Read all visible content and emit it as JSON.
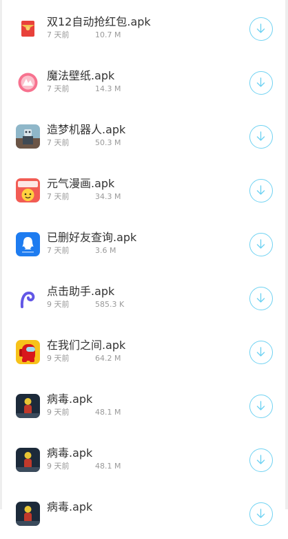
{
  "files": [
    {
      "name": "双12自动抢红包.apk",
      "age": "7 天前",
      "size": "10.7 M",
      "icon": "red-envelope-app-icon"
    },
    {
      "name": "魔法壁纸.apk",
      "age": "7 天前",
      "size": "14.3 M",
      "icon": "magic-wallpaper-app-icon"
    },
    {
      "name": "造梦机器人.apk",
      "age": "7 天前",
      "size": "50.3 M",
      "icon": "robot-app-icon"
    },
    {
      "name": "元气漫画.apk",
      "age": "7 天前",
      "size": "34.3 M",
      "icon": "comic-app-icon"
    },
    {
      "name": "已删好友查询.apk",
      "age": "7 天前",
      "size": "3.6 M",
      "icon": "qq-app-icon"
    },
    {
      "name": "点击助手.apk",
      "age": "9 天前",
      "size": "585.3 K",
      "icon": "click-assistant-app-icon"
    },
    {
      "name": "在我们之间.apk",
      "age": "9 天前",
      "size": "64.2 M",
      "icon": "among-us-app-icon"
    },
    {
      "name": "病毒.apk",
      "age": "9 天前",
      "size": "48.1 M",
      "icon": "virus-game-app-icon"
    },
    {
      "name": "病毒.apk",
      "age": "9 天前",
      "size": "48.1 M",
      "icon": "virus-game-app-icon"
    },
    {
      "name": "病毒.apk",
      "age": "",
      "size": "",
      "icon": "virus-game-app-icon"
    }
  ],
  "colors": {
    "download_ring": "#6fd2f2",
    "title_text": "#333333",
    "meta_text": "#999999"
  }
}
